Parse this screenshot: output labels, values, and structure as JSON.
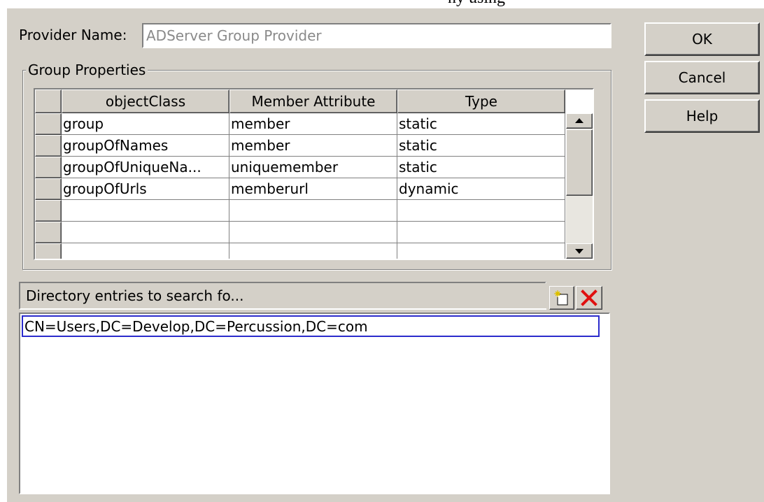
{
  "page_fragment": "ny using",
  "dialog": {
    "provider": {
      "label": "Provider Name:",
      "value": "ADServer Group Provider"
    },
    "buttons": {
      "ok": "OK",
      "cancel": "Cancel",
      "help": "Help"
    },
    "group_properties": {
      "title": "Group Properties",
      "columns": [
        "objectClass",
        "Member Attribute",
        "Type"
      ],
      "rows": [
        [
          "group",
          "member",
          "static"
        ],
        [
          "groupOfNames",
          "member",
          "static"
        ],
        [
          "groupOfUniqueNa...",
          "uniquemember",
          "static"
        ],
        [
          "groupOfUrls",
          "memberurl",
          "dynamic"
        ],
        [
          "",
          "",
          ""
        ],
        [
          "",
          "",
          ""
        ]
      ]
    },
    "directory": {
      "header": "Directory entries to search fo...",
      "icons": {
        "add": "new-entry-icon",
        "delete": "delete-x-icon"
      },
      "entries": [
        "CN=Users,DC=Develop,DC=Percussion,DC=com"
      ]
    },
    "colors": {
      "selection_border": "#2b2bcc",
      "delete_red": "#e01010",
      "dialog_bg": "#d4d0c8"
    }
  }
}
